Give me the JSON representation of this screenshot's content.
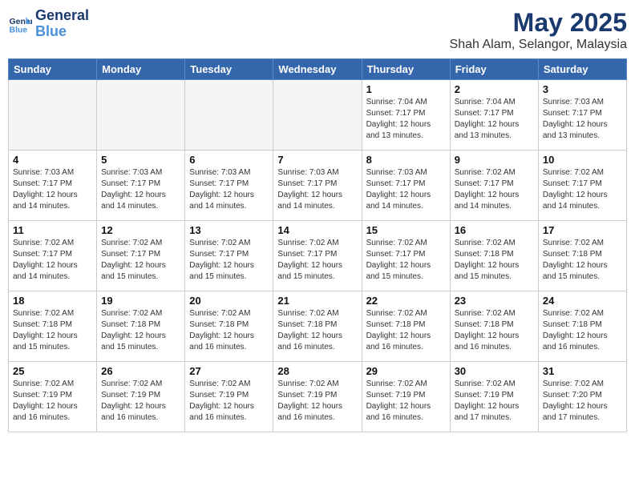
{
  "header": {
    "logo_general": "General",
    "logo_blue": "Blue",
    "month": "May 2025",
    "location": "Shah Alam, Selangor, Malaysia"
  },
  "days_of_week": [
    "Sunday",
    "Monday",
    "Tuesday",
    "Wednesday",
    "Thursday",
    "Friday",
    "Saturday"
  ],
  "weeks": [
    [
      {
        "day": "",
        "empty": true
      },
      {
        "day": "",
        "empty": true
      },
      {
        "day": "",
        "empty": true
      },
      {
        "day": "",
        "empty": true
      },
      {
        "day": "1",
        "sunrise": "7:04 AM",
        "sunset": "7:17 PM",
        "daylight": "12 hours and 13 minutes."
      },
      {
        "day": "2",
        "sunrise": "7:04 AM",
        "sunset": "7:17 PM",
        "daylight": "12 hours and 13 minutes."
      },
      {
        "day": "3",
        "sunrise": "7:03 AM",
        "sunset": "7:17 PM",
        "daylight": "12 hours and 13 minutes."
      }
    ],
    [
      {
        "day": "4",
        "sunrise": "7:03 AM",
        "sunset": "7:17 PM",
        "daylight": "12 hours and 14 minutes."
      },
      {
        "day": "5",
        "sunrise": "7:03 AM",
        "sunset": "7:17 PM",
        "daylight": "12 hours and 14 minutes."
      },
      {
        "day": "6",
        "sunrise": "7:03 AM",
        "sunset": "7:17 PM",
        "daylight": "12 hours and 14 minutes."
      },
      {
        "day": "7",
        "sunrise": "7:03 AM",
        "sunset": "7:17 PM",
        "daylight": "12 hours and 14 minutes."
      },
      {
        "day": "8",
        "sunrise": "7:03 AM",
        "sunset": "7:17 PM",
        "daylight": "12 hours and 14 minutes."
      },
      {
        "day": "9",
        "sunrise": "7:02 AM",
        "sunset": "7:17 PM",
        "daylight": "12 hours and 14 minutes."
      },
      {
        "day": "10",
        "sunrise": "7:02 AM",
        "sunset": "7:17 PM",
        "daylight": "12 hours and 14 minutes."
      }
    ],
    [
      {
        "day": "11",
        "sunrise": "7:02 AM",
        "sunset": "7:17 PM",
        "daylight": "12 hours and 14 minutes."
      },
      {
        "day": "12",
        "sunrise": "7:02 AM",
        "sunset": "7:17 PM",
        "daylight": "12 hours and 15 minutes."
      },
      {
        "day": "13",
        "sunrise": "7:02 AM",
        "sunset": "7:17 PM",
        "daylight": "12 hours and 15 minutes."
      },
      {
        "day": "14",
        "sunrise": "7:02 AM",
        "sunset": "7:17 PM",
        "daylight": "12 hours and 15 minutes."
      },
      {
        "day": "15",
        "sunrise": "7:02 AM",
        "sunset": "7:17 PM",
        "daylight": "12 hours and 15 minutes."
      },
      {
        "day": "16",
        "sunrise": "7:02 AM",
        "sunset": "7:18 PM",
        "daylight": "12 hours and 15 minutes."
      },
      {
        "day": "17",
        "sunrise": "7:02 AM",
        "sunset": "7:18 PM",
        "daylight": "12 hours and 15 minutes."
      }
    ],
    [
      {
        "day": "18",
        "sunrise": "7:02 AM",
        "sunset": "7:18 PM",
        "daylight": "12 hours and 15 minutes."
      },
      {
        "day": "19",
        "sunrise": "7:02 AM",
        "sunset": "7:18 PM",
        "daylight": "12 hours and 15 minutes."
      },
      {
        "day": "20",
        "sunrise": "7:02 AM",
        "sunset": "7:18 PM",
        "daylight": "12 hours and 16 minutes."
      },
      {
        "day": "21",
        "sunrise": "7:02 AM",
        "sunset": "7:18 PM",
        "daylight": "12 hours and 16 minutes."
      },
      {
        "day": "22",
        "sunrise": "7:02 AM",
        "sunset": "7:18 PM",
        "daylight": "12 hours and 16 minutes."
      },
      {
        "day": "23",
        "sunrise": "7:02 AM",
        "sunset": "7:18 PM",
        "daylight": "12 hours and 16 minutes."
      },
      {
        "day": "24",
        "sunrise": "7:02 AM",
        "sunset": "7:18 PM",
        "daylight": "12 hours and 16 minutes."
      }
    ],
    [
      {
        "day": "25",
        "sunrise": "7:02 AM",
        "sunset": "7:19 PM",
        "daylight": "12 hours and 16 minutes."
      },
      {
        "day": "26",
        "sunrise": "7:02 AM",
        "sunset": "7:19 PM",
        "daylight": "12 hours and 16 minutes."
      },
      {
        "day": "27",
        "sunrise": "7:02 AM",
        "sunset": "7:19 PM",
        "daylight": "12 hours and 16 minutes."
      },
      {
        "day": "28",
        "sunrise": "7:02 AM",
        "sunset": "7:19 PM",
        "daylight": "12 hours and 16 minutes."
      },
      {
        "day": "29",
        "sunrise": "7:02 AM",
        "sunset": "7:19 PM",
        "daylight": "12 hours and 16 minutes."
      },
      {
        "day": "30",
        "sunrise": "7:02 AM",
        "sunset": "7:19 PM",
        "daylight": "12 hours and 17 minutes."
      },
      {
        "day": "31",
        "sunrise": "7:02 AM",
        "sunset": "7:20 PM",
        "daylight": "12 hours and 17 minutes."
      }
    ]
  ]
}
